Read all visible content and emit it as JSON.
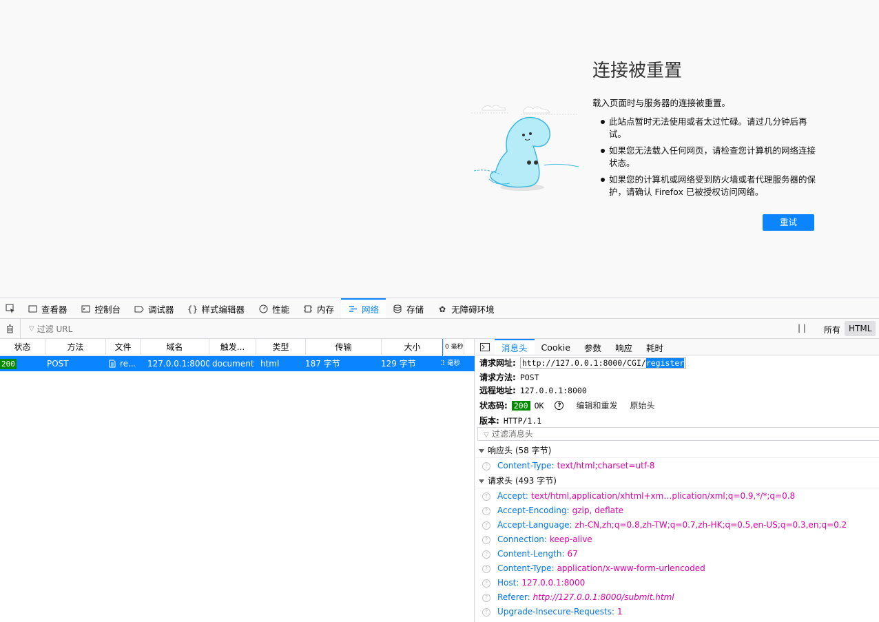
{
  "error_page": {
    "title": "连接被重置",
    "description": "载入页面时与服务器的连接被重置。",
    "bullets": [
      "此站点暂时无法使用或者太过忙碌。请过几分钟后再试。",
      "如果您无法载入任何网页，请检查您计算机的网络连接状态。",
      "如果您的计算机或网络受到防火墙或者代理服务器的保护，请确认 Firefox 已被授权访问网络。"
    ],
    "retry_label": "重试"
  },
  "devtools": {
    "tabs": [
      {
        "label": "查看器",
        "icon": "inspector-icon"
      },
      {
        "label": "控制台",
        "icon": "console-icon"
      },
      {
        "label": "调试器",
        "icon": "debugger-icon"
      },
      {
        "label": "样式编辑器",
        "icon": "style-editor-icon"
      },
      {
        "label": "性能",
        "icon": "performance-icon"
      },
      {
        "label": "内存",
        "icon": "memory-icon"
      },
      {
        "label": "网络",
        "icon": "network-icon"
      },
      {
        "label": "存储",
        "icon": "storage-icon"
      },
      {
        "label": "无障碍环境",
        "icon": "accessibility-icon"
      }
    ],
    "active_tab": "网络",
    "accent": "#0a84ff",
    "toolbar": {
      "filter_placeholder": "过滤 URL",
      "pause": "| |",
      "filter_all": "所有",
      "filter_html": "HTML"
    },
    "columns": [
      "状态",
      "方法",
      "文件",
      "域名",
      "触发...",
      "类型",
      "传输",
      "大小",
      "0 毫秒"
    ],
    "request": {
      "status": "200",
      "method": "POST",
      "file": "re...",
      "domain": "127.0.0.1:8000",
      "cause": "document",
      "type": "html",
      "transferred": "187 字节",
      "size": "129 字节",
      "time": "2 毫秒"
    },
    "details": {
      "tabs": [
        "消息头",
        "Cookie",
        "参数",
        "响应",
        "耗时"
      ],
      "active_tab": "消息头",
      "request_url_label": "请求网址:",
      "request_url_prefix": "http://127.0.0.1:8000/CGI/",
      "request_url_selected": "register",
      "method_label": "请求方法:",
      "method": "POST",
      "remote_label": "远程地址:",
      "remote": "127.0.0.1:8000",
      "status_label": "状态码:",
      "status_code": "200",
      "status_text": "OK",
      "edit_resend": "编辑和重发",
      "raw_headers": "原始头",
      "version_label": "版本:",
      "version": "HTTP/1.1",
      "filter_headers": "过滤消息头",
      "response_section": "响应头 (58 字节)",
      "response_headers": [
        {
          "key": "Content-Type:",
          "value": "text/html;charset=utf-8"
        }
      ],
      "request_section": "请求头 (493 字节)",
      "request_headers": [
        {
          "key": "Accept:",
          "value": "text/html,application/xhtml+xm…plication/xml;q=0.9,*/*;q=0.8"
        },
        {
          "key": "Accept-Encoding:",
          "value": "gzip, deflate"
        },
        {
          "key": "Accept-Language:",
          "value": "zh-CN,zh;q=0.8,zh-TW;q=0.7,zh-HK;q=0.5,en-US;q=0.3,en;q=0.2"
        },
        {
          "key": "Connection:",
          "value": "keep-alive"
        },
        {
          "key": "Content-Length:",
          "value": "67"
        },
        {
          "key": "Content-Type:",
          "value": "application/x-www-form-urlencoded"
        },
        {
          "key": "Host:",
          "value": "127.0.0.1:8000"
        },
        {
          "key": "Referer:",
          "value": "http://127.0.0.1:8000/submit.html"
        },
        {
          "key": "Upgrade-Insecure-Requests:",
          "value": "1"
        }
      ]
    }
  }
}
